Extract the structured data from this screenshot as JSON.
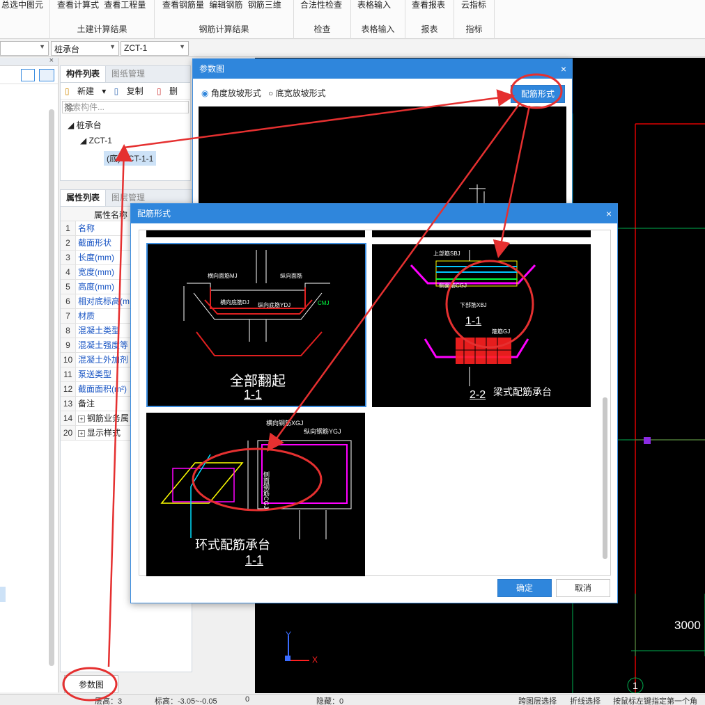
{
  "ribbon": {
    "groups": [
      {
        "items": [
          "总选中图元"
        ],
        "label": ""
      },
      {
        "items": [
          "查看计算式",
          "查看工程量"
        ],
        "label": "土建计算结果"
      },
      {
        "items": [
          "查看钢筋量",
          "编辑钢筋",
          "钢筋三维"
        ],
        "label": "钢筋计算结果"
      },
      {
        "items": [
          "合法性检查"
        ],
        "label": "检查"
      },
      {
        "items": [
          "表格输入"
        ],
        "label": "表格输入"
      },
      {
        "items": [
          "查看报表"
        ],
        "label": "报表"
      },
      {
        "items": [
          "云指标"
        ],
        "label": "指标"
      }
    ]
  },
  "selectors": {
    "first": "桩承台",
    "second": "ZCT-1"
  },
  "component_panel": {
    "tabs": [
      "构件列表",
      "图纸管理"
    ],
    "toolbar": {
      "new": "新建",
      "copy": "复制",
      "delete": "删除"
    },
    "search_placeholder": "搜索构件...",
    "tree": {
      "root": "桩承台",
      "child": "ZCT-1",
      "leaf_prefix": "(底)",
      "leaf": "ZCT-1-1"
    }
  },
  "property_panel": {
    "tabs": [
      "属性列表",
      "图层管理"
    ],
    "header": "属性名称",
    "rows": [
      {
        "num": "1",
        "name": "名称"
      },
      {
        "num": "2",
        "name": "截面形状"
      },
      {
        "num": "3",
        "name": "长度(mm)"
      },
      {
        "num": "4",
        "name": "宽度(mm)"
      },
      {
        "num": "5",
        "name": "高度(mm)"
      },
      {
        "num": "6",
        "name": "相对底标高(m"
      },
      {
        "num": "7",
        "name": "材质"
      },
      {
        "num": "8",
        "name": "混凝土类型"
      },
      {
        "num": "9",
        "name": "混凝土强度等级"
      },
      {
        "num": "10",
        "name": "混凝土外加剂"
      },
      {
        "num": "11",
        "name": "泵送类型"
      },
      {
        "num": "12",
        "name": "截面面积(m²)"
      },
      {
        "num": "13",
        "name": "备注"
      },
      {
        "num": "14",
        "name": "钢筋业务属"
      },
      {
        "num": "20",
        "name": "显示样式"
      }
    ]
  },
  "param_button": "参数图",
  "param_dialog": {
    "title": "参数图",
    "radio1": "角度放坡形式",
    "radio2": "底宽放坡形式",
    "rebar_button": "配筋形式"
  },
  "rebar_dialog": {
    "title": "配筋形式",
    "ok": "确定",
    "cancel": "取消",
    "thumb1": {
      "title": "全部翻起",
      "section": "1-1",
      "labels": [
        "横向面筋MJ",
        "纵向面筋",
        "横向底筋DJ",
        "纵向底筋YDJ",
        "CMJ"
      ]
    },
    "thumb2": {
      "title": "梁式配筋承台",
      "section_top": "1-1",
      "section_bottom": "2-2",
      "labels": [
        "上部筋SBJ",
        "侧面筋CGJ",
        "下部筋XBJ",
        "箍筋GJ"
      ]
    },
    "thumb3": {
      "title": "环式配筋承台",
      "section": "1-1",
      "labels": [
        "横向钢筋XGJ",
        "纵向钢筋YGJ",
        "侧面钢筋CGJ"
      ]
    }
  },
  "cad": {
    "dimension": "3000",
    "axis_label": "1",
    "x_label": "X",
    "y_label": "Y"
  },
  "status": {
    "floor": "层高：3",
    "elevation": "标高：-3.05~-0.05",
    "extra": "0",
    "hidden": "隐藏：0",
    "s1": "跨图层选择",
    "s2": "折线选择",
    "s3": "按鼠标左键指定第一个角"
  }
}
